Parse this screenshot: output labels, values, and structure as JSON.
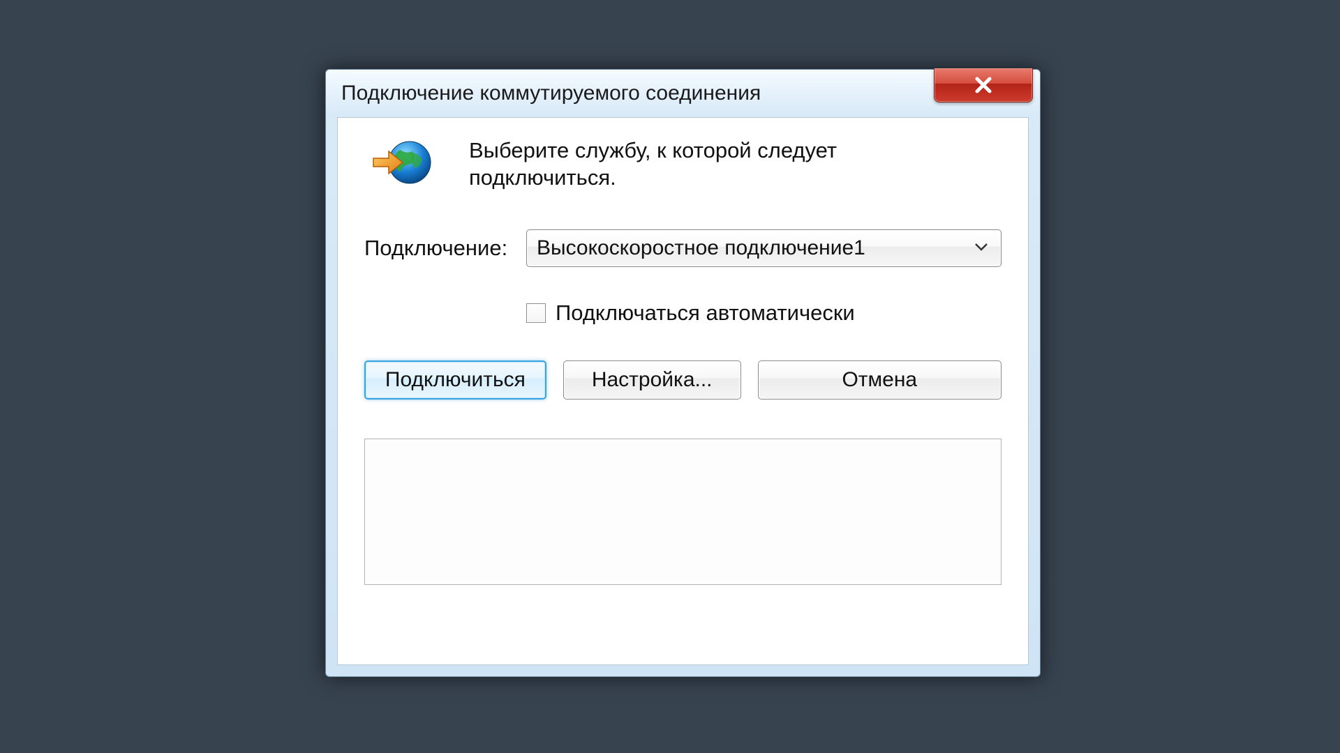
{
  "dialog": {
    "title": "Подключение коммутируемого соединения",
    "intro": "Выберите службу, к которой следует подключиться.",
    "connection_label": "Подключение:",
    "connection_selected": "Высокоскоростное подключение1",
    "auto_connect_label": "Подключаться автоматически",
    "auto_connect_checked": false,
    "buttons": {
      "connect": "Подключиться",
      "settings": "Настройка...",
      "cancel": "Отмена"
    }
  }
}
